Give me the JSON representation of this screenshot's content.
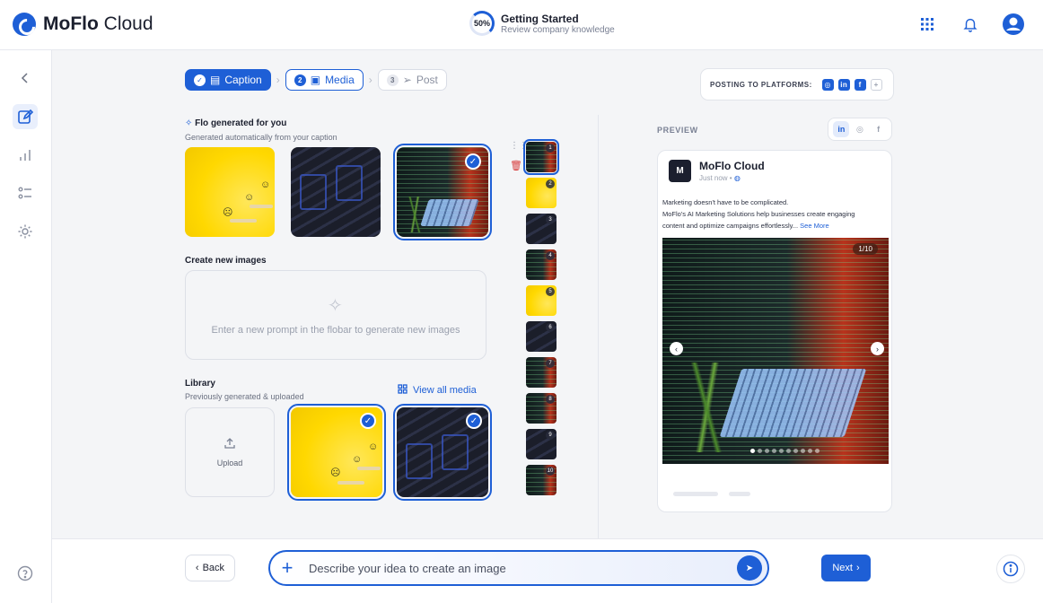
{
  "app": {
    "brand_bold": "MoFlo",
    "brand_light": "Cloud"
  },
  "getting_started": {
    "percent": "50%",
    "title": "Getting Started",
    "subtitle": "Review company knowledge"
  },
  "steps": [
    {
      "num": "✓",
      "label": "Caption",
      "state": "done"
    },
    {
      "num": "2",
      "label": "Media",
      "state": "current"
    },
    {
      "num": "3",
      "label": "Post",
      "state": "pending"
    }
  ],
  "platforms": {
    "label": "POSTING TO PLATFORMS:",
    "items": [
      "instagram",
      "linkedin",
      "facebook"
    ],
    "add": "+"
  },
  "flo": {
    "title": "Flo generated for you",
    "subtitle": "Generated automatically from your caption"
  },
  "create": {
    "title": "Create new images",
    "hint": "Enter a new prompt in the flobar to generate new images"
  },
  "library": {
    "title": "Library",
    "subtitle": "Previously generated & uploaded",
    "view_all": "View all media",
    "upload": "Upload"
  },
  "thumbnails": [
    "1",
    "2",
    "3",
    "4",
    "5",
    "6",
    "7",
    "8",
    "9",
    "10"
  ],
  "preview": {
    "label": "PREVIEW",
    "account": "MoFlo Cloud",
    "avatar": "M",
    "time": "Just now •",
    "line1": "Marketing doesn't have to be complicated.",
    "line2": "MoFlo's AI Marketing Solutions help businesses create engaging",
    "line3": "content and optimize campaigns effortlessly...",
    "see_more": "See More",
    "counter": "1/10"
  },
  "bottom": {
    "back": "Back",
    "prompt_placeholder": "Describe your idea to create an image",
    "next": "Next"
  },
  "colors": {
    "accent": "#1e5fd6"
  }
}
